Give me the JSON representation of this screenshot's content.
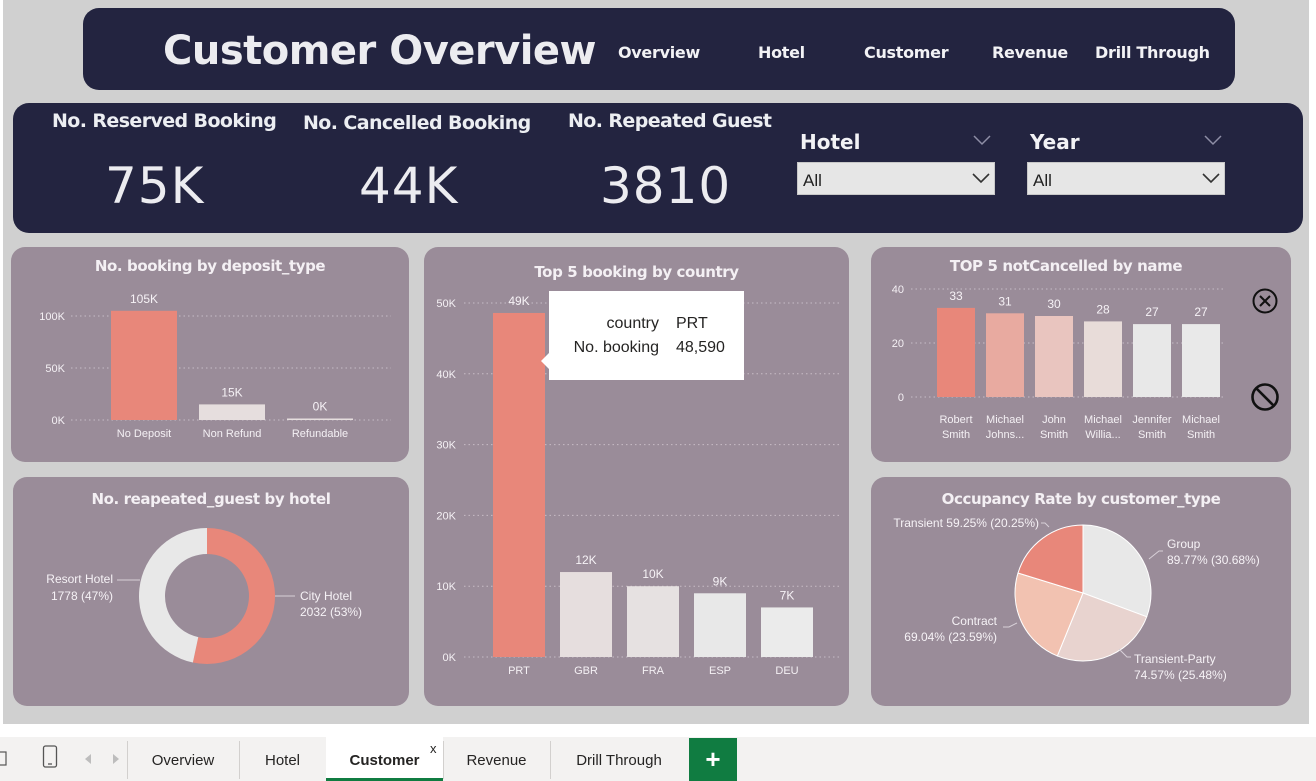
{
  "header": {
    "title": "Customer Overview",
    "nav": [
      "Overview",
      "Hotel",
      "Customer",
      "Revenue",
      "Drill Through"
    ]
  },
  "kpis": [
    {
      "label": "No. Reserved Booking",
      "value": "75K"
    },
    {
      "label": "No. Cancelled Booking",
      "value": "44K"
    },
    {
      "label": "No. Repeated Guest",
      "value": "3810"
    }
  ],
  "slicers": [
    {
      "label": "Hotel",
      "value": "All"
    },
    {
      "label": "Year",
      "value": "All"
    }
  ],
  "colors": {
    "navy": "#232440",
    "panel": "#9a8c99",
    "accent": "#e8877a",
    "pale": "#e6dede",
    "tab_active": "#107c41"
  },
  "icons": {
    "clear": "circle-x-icon",
    "disable": "prohibited-icon",
    "add": "plus-icon"
  },
  "chart_data": [
    {
      "type": "bar",
      "title": "No. booking by deposit_type",
      "categories": [
        "No Deposit",
        "Non Refund",
        "Refundable"
      ],
      "values": [
        105000,
        15000,
        0
      ],
      "data_labels": [
        "105K",
        "15K",
        "0K"
      ],
      "yticks": [
        "0K",
        "50K",
        "100K"
      ],
      "ylim": [
        0,
        100000
      ],
      "grid": true
    },
    {
      "type": "bar",
      "title": "Top 5 booking by country",
      "categories": [
        "PRT",
        "GBR",
        "FRA",
        "ESP",
        "DEU"
      ],
      "values": [
        48590,
        12000,
        10000,
        9000,
        7000
      ],
      "data_labels": [
        "49K",
        "12K",
        "10K",
        "9K",
        "7K"
      ],
      "yticks": [
        "0K",
        "10K",
        "20K",
        "30K",
        "40K",
        "50K"
      ],
      "ylim": [
        0,
        50000
      ],
      "grid": true,
      "tooltip": {
        "rows": [
          {
            "key": "country",
            "value": "PRT"
          },
          {
            "key": "No. booking",
            "value": "48,590"
          }
        ]
      }
    },
    {
      "type": "bar",
      "title": "TOP 5 notCancelled by name",
      "categories": [
        [
          "Robert",
          "Smith"
        ],
        [
          "Michael",
          "Johns..."
        ],
        [
          "John",
          "Smith"
        ],
        [
          "Michael",
          "Willia..."
        ],
        [
          "Jennifer",
          "Smith"
        ],
        [
          "Michael",
          "Smith"
        ]
      ],
      "values": [
        33,
        31,
        30,
        28,
        27,
        27
      ],
      "data_labels": [
        "33",
        "31",
        "30",
        "28",
        "27",
        "27"
      ],
      "yticks": [
        "0",
        "20",
        "40"
      ],
      "ylim": [
        0,
        40
      ],
      "grid": true
    },
    {
      "type": "pie",
      "title": "No. reapeated_guest by hotel",
      "donut": true,
      "slices": [
        {
          "name": "City Hotel",
          "value": 2032,
          "pct": "53%",
          "label": [
            "City Hotel",
            "2032 (53%)"
          ]
        },
        {
          "name": "Resort Hotel",
          "value": 1778,
          "pct": "47%",
          "label": [
            "Resort Hotel",
            "1778 (47%)"
          ]
        }
      ]
    },
    {
      "type": "pie",
      "title": "Occupancy Rate by customer_type",
      "slices": [
        {
          "name": "Group",
          "value": 30.68,
          "label": [
            "Group",
            "89.77% (30.68%)"
          ]
        },
        {
          "name": "Transient-Party",
          "value": 25.48,
          "label": [
            "Transient-Party",
            "74.57% (25.48%)"
          ]
        },
        {
          "name": "Contract",
          "value": 23.59,
          "label": [
            "Contract",
            "69.04% (23.59%)"
          ]
        },
        {
          "name": "Transient",
          "value": 20.25,
          "label": [
            "Transient 59.25% (20.25%)"
          ]
        }
      ]
    }
  ],
  "tabs": {
    "items": [
      "Overview",
      "Hotel",
      "Customer",
      "Revenue",
      "Drill Through"
    ],
    "active": "Customer",
    "close_glyph": "x",
    "add_glyph": "+"
  }
}
